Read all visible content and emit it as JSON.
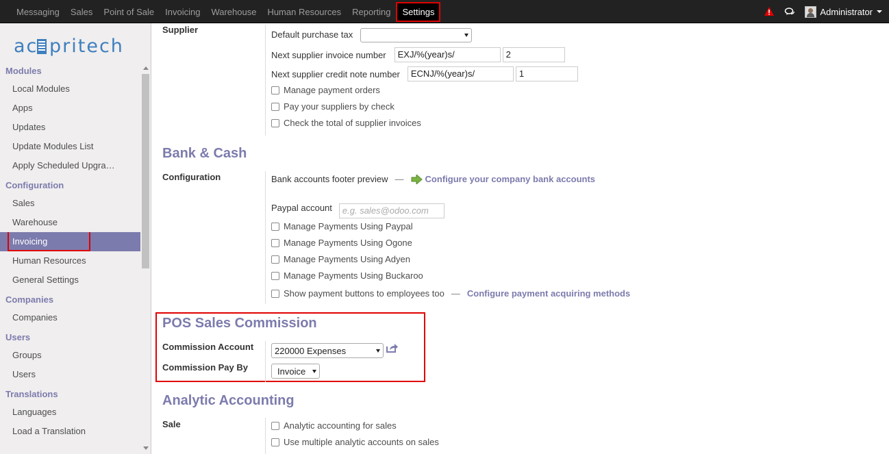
{
  "topbar": {
    "menu": [
      "Messaging",
      "Sales",
      "Point of Sale",
      "Invoicing",
      "Warehouse",
      "Human Resources",
      "Reporting",
      "Settings"
    ],
    "active": "Settings",
    "user": "Administrator"
  },
  "sidebar": {
    "logo": "acsspritech",
    "sections": [
      {
        "title": "Modules",
        "items": [
          "Local Modules",
          "Apps",
          "Updates",
          "Update Modules List",
          "Apply Scheduled Upgra…"
        ]
      },
      {
        "title": "Configuration",
        "items": [
          "Sales",
          "Warehouse",
          "Invoicing",
          "Human Resources",
          "General Settings"
        ]
      },
      {
        "title": "Companies",
        "items": [
          "Companies"
        ]
      },
      {
        "title": "Users",
        "items": [
          "Groups",
          "Users"
        ]
      },
      {
        "title": "Translations",
        "items": [
          "Languages",
          "Load a Translation"
        ]
      }
    ],
    "active_item": "Invoicing"
  },
  "supplier": {
    "label": "Supplier",
    "default_purchase_tax_label": "Default purchase tax",
    "default_purchase_tax_value": "",
    "next_invoice_label": "Next supplier invoice number",
    "next_invoice_prefix": "EXJ/%(year)s/",
    "next_invoice_number": "2",
    "next_credit_label": "Next supplier credit note number",
    "next_credit_prefix": "ECNJ/%(year)s/",
    "next_credit_number": "1",
    "options": [
      "Manage payment orders",
      "Pay your suppliers by check",
      "Check the total of supplier invoices"
    ]
  },
  "bank_cash": {
    "heading": "Bank & Cash",
    "label": "Configuration",
    "footer_preview_label": "Bank accounts footer preview",
    "dash": "—",
    "configure_bank_link": "Configure your company bank accounts",
    "paypal_label": "Paypal account",
    "paypal_placeholder": "e.g. sales@odoo.com",
    "options": [
      "Manage Payments Using Paypal",
      "Manage Payments Using Ogone",
      "Manage Payments Using Adyen",
      "Manage Payments Using Buckaroo"
    ],
    "show_buttons_label": "Show payment buttons to employees too",
    "configure_acquiring_link": "Configure payment acquiring methods"
  },
  "pos_commission": {
    "heading": "POS Sales Commission",
    "account_label": "Commission Account",
    "account_value": "220000 Expenses",
    "pay_by_label": "Commission Pay By",
    "pay_by_value": "Invoice"
  },
  "analytic": {
    "heading": "Analytic Accounting",
    "label": "Sale",
    "options": [
      "Analytic accounting for sales",
      "Use multiple analytic accounts on sales"
    ]
  },
  "colors": {
    "accent": "#7c7bad",
    "topbar": "#222222",
    "highlight": "#e00000"
  }
}
